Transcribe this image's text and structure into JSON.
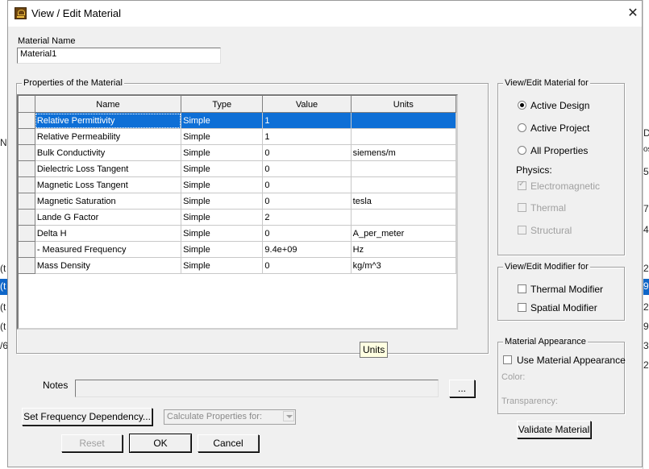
{
  "background_app": {
    "left_fragments": [
      "N",
      "(t",
      "(t",
      "(t",
      "(t",
      "/6"
    ],
    "right_fragments": [
      "D",
      "os",
      "5",
      "7",
      "4",
      "2",
      "9",
      "2",
      "9",
      "3",
      "2"
    ]
  },
  "window": {
    "title": "View / Edit Material",
    "close_glyph": "✕",
    "icon": "app-logo-icon"
  },
  "material_name": {
    "label": "Material Name",
    "value": "Material1"
  },
  "properties": {
    "group_label": "Properties of the Material",
    "columns": [
      "Name",
      "Type",
      "Value",
      "Units"
    ],
    "rows": [
      {
        "name": "Relative Permittivity",
        "type": "Simple",
        "value": "1",
        "units": ""
      },
      {
        "name": "Relative Permeability",
        "type": "Simple",
        "value": "1",
        "units": ""
      },
      {
        "name": "Bulk Conductivity",
        "type": "Simple",
        "value": "0",
        "units": "siemens/m"
      },
      {
        "name": "Dielectric Loss Tangent",
        "type": "Simple",
        "value": "0",
        "units": ""
      },
      {
        "name": "Magnetic Loss Tangent",
        "type": "Simple",
        "value": "0",
        "units": ""
      },
      {
        "name": "Magnetic Saturation",
        "type": "Simple",
        "value": "0",
        "units": "tesla"
      },
      {
        "name": "Lande G Factor",
        "type": "Simple",
        "value": "2",
        "units": ""
      },
      {
        "name": "Delta H",
        "type": "Simple",
        "value": "0",
        "units": "A_per_meter"
      },
      {
        "name": "-  Measured Frequency",
        "type": "Simple",
        "value": "9.4e+09",
        "units": "Hz"
      },
      {
        "name": "Mass Density",
        "type": "Simple",
        "value": "0",
        "units": "kg/m^3"
      }
    ],
    "tooltip": "Units"
  },
  "view_edit_for": {
    "group_label": "View/Edit Material for",
    "options": [
      "Active Design",
      "Active Project",
      "All Properties"
    ],
    "selected": "Active Design",
    "physics_label": "Physics:",
    "physics": [
      {
        "label": "Electromagnetic",
        "checked": true
      },
      {
        "label": "Thermal",
        "checked": false
      },
      {
        "label": "Structural",
        "checked": false
      }
    ]
  },
  "modifier": {
    "group_label": "View/Edit Modifier for",
    "options": [
      "Thermal Modifier",
      "Spatial Modifier"
    ]
  },
  "appearance": {
    "group_label": "Material Appearance",
    "use_label": "Use Material Appearance",
    "color_label": "Color:",
    "transparency_label": "Transparency:"
  },
  "notes": {
    "label": "Notes",
    "value": "",
    "browse_label": "..."
  },
  "buttons": {
    "set_freq": "Set Frequency Dependency...",
    "calc_props": "Calculate Properties for:",
    "validate": "Validate Material",
    "reset": "Reset",
    "ok": "OK",
    "cancel": "Cancel"
  },
  "colors": {
    "selection": "#0e6fd6",
    "dialog_bg": "#f0f0f0",
    "tooltip_bg": "#ffffe1"
  }
}
